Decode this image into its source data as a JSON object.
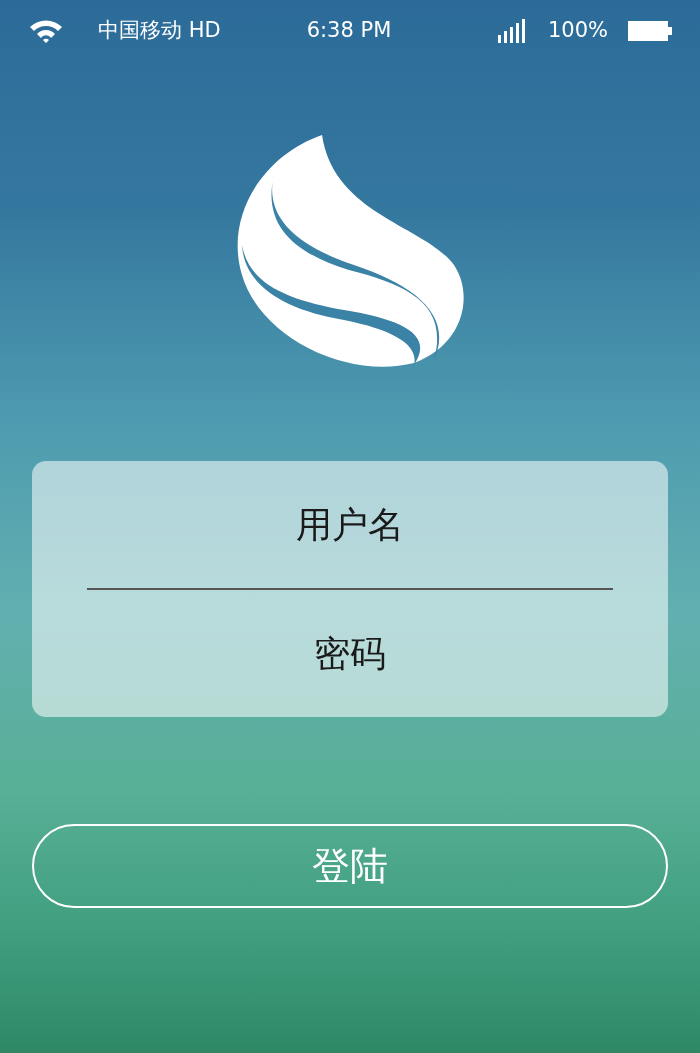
{
  "status_bar": {
    "carrier": "中国移动 HD",
    "time": "6:38 PM",
    "battery": "100%"
  },
  "login_form": {
    "fields": [
      {
        "placeholder": "用户名"
      },
      {
        "placeholder": "密码"
      }
    ]
  },
  "login_button": {
    "label": "登陆"
  }
}
